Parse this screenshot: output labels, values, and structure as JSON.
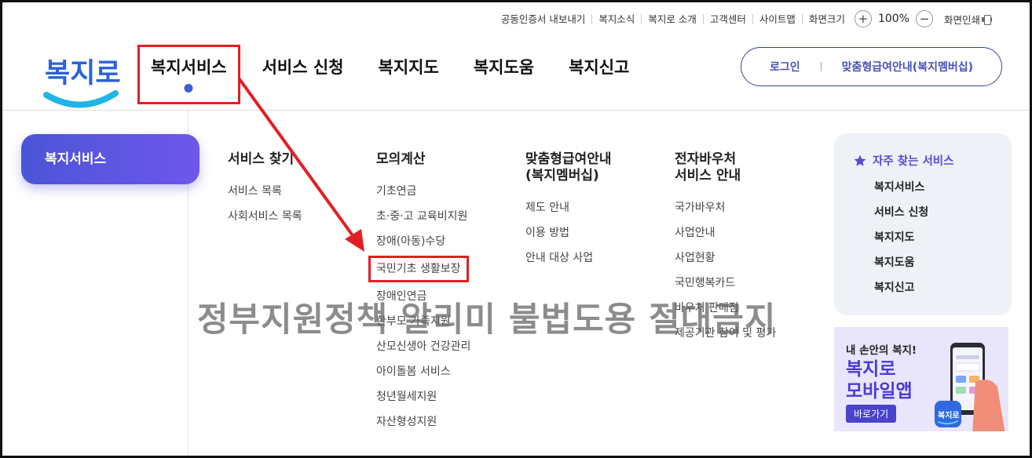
{
  "utility_bar": {
    "items": [
      "공동인증서 내보내기",
      "복지소식",
      "복지로 소개",
      "고객센터",
      "사이트맵",
      "화면크기"
    ],
    "zoom_minus": "−",
    "zoom_plus": "+",
    "zoom_level": "100%",
    "print_label": "화면인쇄"
  },
  "logo": {
    "text": "복지로"
  },
  "main_nav": [
    "복지서비스",
    "서비스 신청",
    "복지지도",
    "복지도움",
    "복지신고"
  ],
  "login": {
    "login_label": "로그인",
    "membership_label": "맞춤형급여안내(복지멤버십)"
  },
  "side": {
    "active_menu": "복지서비스"
  },
  "menu": {
    "columns": [
      {
        "title": "서비스 찾기",
        "items": [
          "서비스 목록",
          "사회서비스 목록"
        ]
      },
      {
        "title": "모의계산",
        "items": [
          "기초연금",
          "초·중·고 교육비지원",
          "장애(아동)수당",
          "국민기초 생활보장",
          "장애인연금",
          "한부모 가족지원",
          "산모신생아 건강관리",
          "아이돌봄 서비스",
          "청년월세지원",
          "자산형성지원"
        ]
      },
      {
        "title": "맞춤형급여안내\n(복지멤버십)",
        "items": [
          "제도 안내",
          "이용 방법",
          "안내 대상 사업"
        ]
      },
      {
        "title": "전자바우처\n서비스 안내",
        "items": [
          "국가바우처",
          "사업안내",
          "사업현황",
          "국민행복카드",
          "바우처 판매점",
          "제공기관 참여 및 평가"
        ]
      }
    ]
  },
  "favorites": {
    "title": "자주 찾는 서비스",
    "items": [
      "복지서비스",
      "서비스 신청",
      "복지지도",
      "복지도움",
      "복지신고"
    ]
  },
  "banner": {
    "line1": "내 손안의 복지!",
    "line2": "복지로\n모바일앱",
    "button": "바로가기",
    "app_icon_text": "복지로"
  },
  "watermark": "정부지원정책 알리미 불법도용 절대금지",
  "colors": {
    "accent": "#4b55d6",
    "accent2": "#6e57ec",
    "highlight_red": "#e31e24",
    "logo_blue": "#2a62d8",
    "logo_cyan": "#1fb5e8"
  },
  "icons": {
    "star": "star-icon",
    "print": "printer-icon",
    "phone": "phone-illustration"
  }
}
